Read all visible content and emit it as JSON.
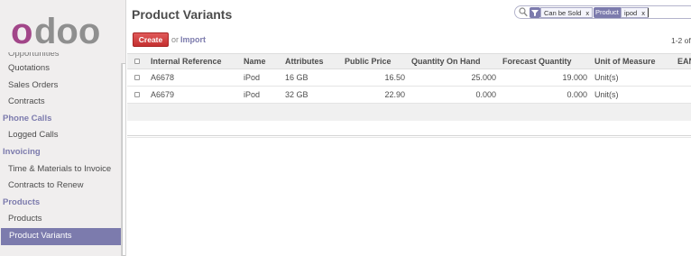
{
  "brand": {
    "logo_text": "odoo",
    "logo_colors": [
      "#a24689",
      "#8f8f8f"
    ]
  },
  "sidebar": {
    "items": [
      {
        "type": "cut",
        "label": "Opportunities"
      },
      {
        "type": "item",
        "label": "Quotations"
      },
      {
        "type": "item",
        "label": "Sales Orders"
      },
      {
        "type": "item",
        "label": "Contracts"
      },
      {
        "type": "header",
        "label": "Phone Calls"
      },
      {
        "type": "item",
        "label": "Logged Calls"
      },
      {
        "type": "header",
        "label": "Invoicing"
      },
      {
        "type": "item",
        "label": "Time & Materials to Invoice"
      },
      {
        "type": "item",
        "label": "Contracts to Renew"
      },
      {
        "type": "header",
        "label": "Products"
      },
      {
        "type": "item",
        "label": "Products"
      },
      {
        "type": "item",
        "label": "Product Variants",
        "active": true
      }
    ]
  },
  "header": {
    "title": "Product Variants"
  },
  "search": {
    "search_icon": "search-icon",
    "filter_icon": "filter-icon",
    "facets": [
      {
        "value": "Can be Sold"
      },
      {
        "category": "Product",
        "value": "ipod"
      }
    ],
    "remove_glyph": "x"
  },
  "toolbar": {
    "create_label": "Create",
    "or_text": "or",
    "import_label": "Import"
  },
  "pager": {
    "text": "1-2 of"
  },
  "table": {
    "columns": [
      "Internal Reference",
      "Name",
      "Attributes",
      "Public Price",
      "Quantity On Hand",
      "Forecast Quantity",
      "Unit of Measure",
      "EAN"
    ],
    "rows": [
      {
        "ref": "A6678",
        "name": "iPod",
        "attributes": "16 GB",
        "price": "16.50",
        "qty": "25.000",
        "forecast": "19.000",
        "uom": "Unit(s)"
      },
      {
        "ref": "A6679",
        "name": "iPod",
        "attributes": "32 GB",
        "price": "22.90",
        "qty": "0.000",
        "forecast": "0.000",
        "uom": "Unit(s)"
      }
    ]
  },
  "colors": {
    "accent": "#7c7bad",
    "create": "#d64545"
  }
}
